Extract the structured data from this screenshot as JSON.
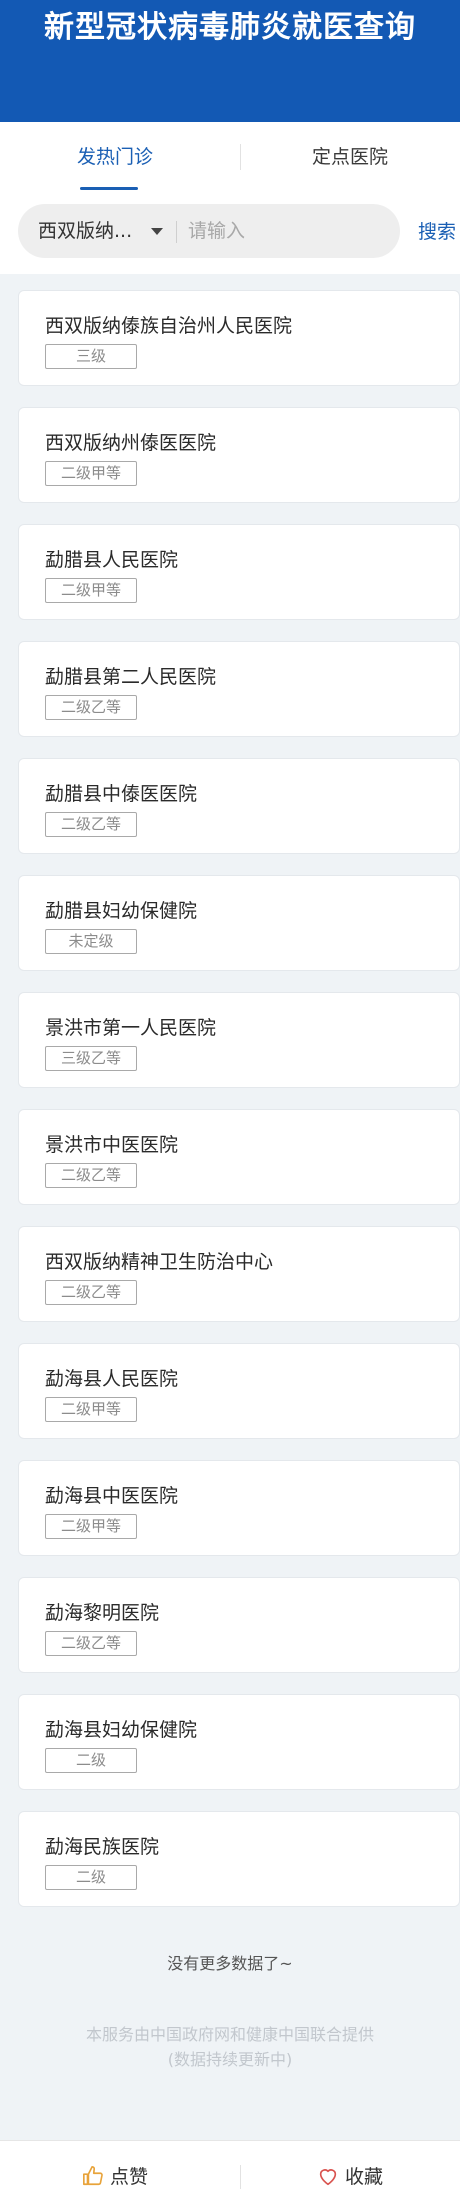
{
  "header": {
    "title": "新型冠状病毒肺炎就医查询"
  },
  "tabs": [
    {
      "label": "发热门诊",
      "active": true
    },
    {
      "label": "定点医院",
      "active": false
    }
  ],
  "search": {
    "region": "西双版纳...",
    "placeholder": "请输入",
    "button_label": "搜索"
  },
  "hospitals": [
    {
      "name": "西双版纳傣族自治州人民医院",
      "level": "三级"
    },
    {
      "name": "西双版纳州傣医医院",
      "level": "二级甲等"
    },
    {
      "name": "勐腊县人民医院",
      "level": "二级甲等"
    },
    {
      "name": "勐腊县第二人民医院",
      "level": "二级乙等"
    },
    {
      "name": "勐腊县中傣医医院",
      "level": "二级乙等"
    },
    {
      "name": "勐腊县妇幼保健院",
      "level": "未定级"
    },
    {
      "name": "景洪市第一人民医院",
      "level": "三级乙等"
    },
    {
      "name": "景洪市中医医院",
      "level": "二级乙等"
    },
    {
      "name": "西双版纳精神卫生防治中心",
      "level": "二级乙等"
    },
    {
      "name": "勐海县人民医院",
      "level": "二级甲等"
    },
    {
      "name": "勐海县中医医院",
      "level": "二级甲等"
    },
    {
      "name": "勐海黎明医院",
      "level": "二级乙等"
    },
    {
      "name": "勐海县妇幼保健院",
      "level": "二级"
    },
    {
      "name": "勐海民族医院",
      "level": "二级"
    }
  ],
  "list_end": "没有更多数据了~",
  "footnote": {
    "line1": "本服务由中国政府网和健康中国联合提供",
    "line2": "(数据持续更新中)"
  },
  "bottom_bar": {
    "like_label": "点赞",
    "favorite_label": "收藏",
    "accent_color": "#e8a33a",
    "heart_color": "#d9534f"
  },
  "colors": {
    "brand": "#1359b4",
    "link": "#1a5fb4"
  }
}
